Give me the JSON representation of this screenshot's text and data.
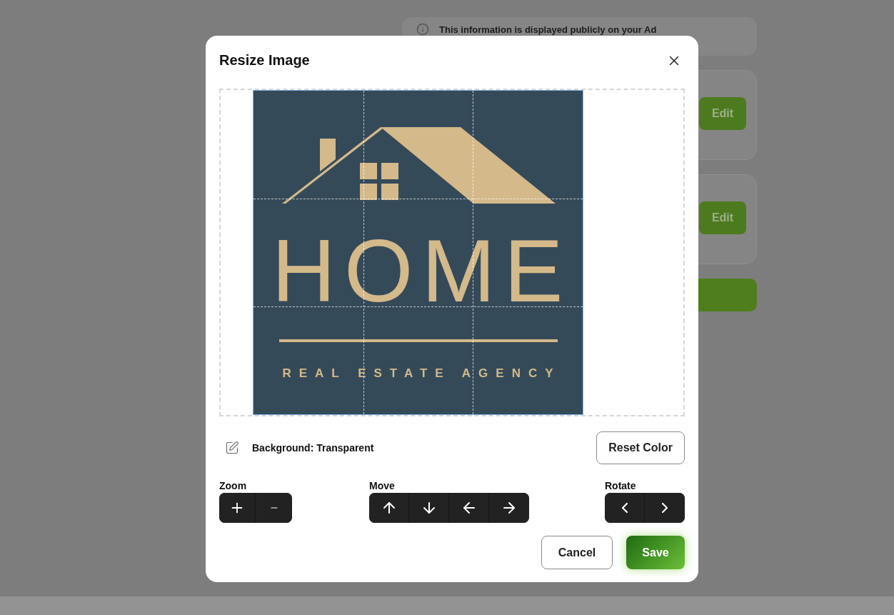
{
  "background": {
    "notice": "This information is displayed publicly on your Ad",
    "cards": [
      {
        "button": "Edit"
      },
      {
        "button": "Edit"
      }
    ]
  },
  "dialog": {
    "title": "Resize Image",
    "image": {
      "title": "HOME",
      "subtitle": "REAL ESTATE AGENCY"
    },
    "background_label": "Background: Transparent",
    "reset_button": "Reset Color",
    "controls": [
      {
        "label": "Zoom",
        "buttons": [
          {
            "kind": "plus"
          },
          {
            "kind": "minus"
          }
        ]
      },
      {
        "label": "Move",
        "buttons": [
          {
            "kind": "up"
          },
          {
            "kind": "down"
          },
          {
            "kind": "left"
          },
          {
            "kind": "right"
          }
        ]
      },
      {
        "label": "Rotate",
        "buttons": [
          {
            "kind": "rotate-left"
          },
          {
            "kind": "rotate-right"
          }
        ]
      }
    ],
    "buttons": [
      {
        "label": "Cancel",
        "kind": "secondary"
      },
      {
        "label": "Save",
        "kind": "primary"
      }
    ]
  }
}
